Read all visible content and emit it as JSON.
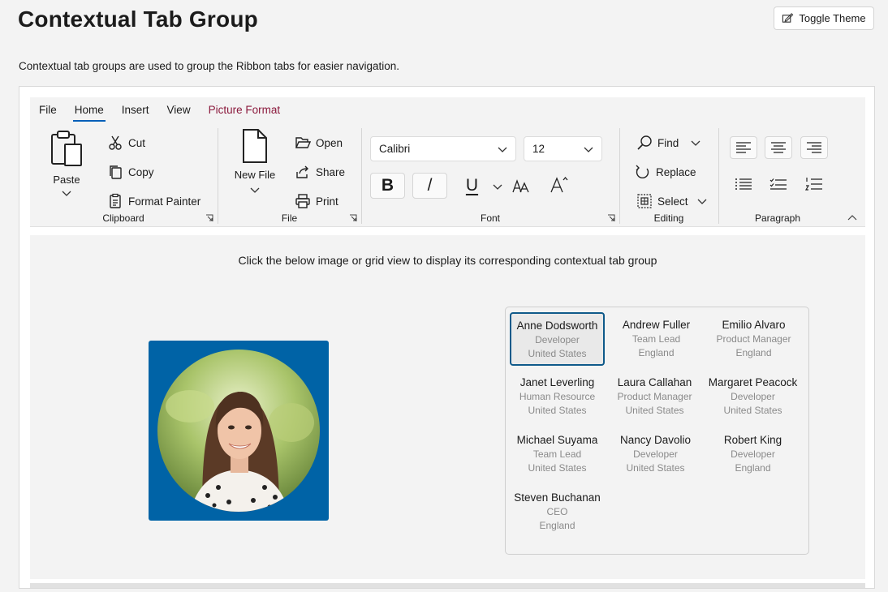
{
  "page": {
    "title": "Contextual Tab Group",
    "toggle_theme": "Toggle Theme",
    "description": "Contextual tab groups are used to group the Ribbon tabs for easier navigation."
  },
  "ribbon": {
    "tabs": [
      "File",
      "Home",
      "Insert",
      "View",
      "Picture Format"
    ],
    "active_tab": "Home",
    "contextual_tab": "Picture Format",
    "contextual_color": "#8b1a3d",
    "accent_color": "#005fb8",
    "clipboard": {
      "label": "Clipboard",
      "paste": "Paste",
      "cut": "Cut",
      "copy": "Copy",
      "format_painter": "Format Painter"
    },
    "file": {
      "label": "File",
      "new_file": "New File",
      "open": "Open",
      "share": "Share",
      "print": "Print"
    },
    "font": {
      "label": "Font",
      "family": "Calibri",
      "size": "12",
      "bold": "B",
      "italic": "/",
      "underline": "U"
    },
    "editing": {
      "label": "Editing",
      "find": "Find",
      "replace": "Replace",
      "select": "Select"
    },
    "paragraph": {
      "label": "Paragraph"
    }
  },
  "content": {
    "hint": "Click the below image or grid view to display its corresponding contextual tab group",
    "photo_frame_color": "#0063a6"
  },
  "people": [
    {
      "name": "Anne Dodsworth",
      "title": "Developer",
      "country": "United States",
      "selected": true
    },
    {
      "name": "Andrew Fuller",
      "title": "Team Lead",
      "country": "England"
    },
    {
      "name": "Emilio Alvaro",
      "title": "Product Manager",
      "country": "England"
    },
    {
      "name": "Janet Leverling",
      "title": "Human Resource",
      "country": "United States"
    },
    {
      "name": "Laura Callahan",
      "title": "Product Manager",
      "country": "United States"
    },
    {
      "name": "Margaret Peacock",
      "title": "Developer",
      "country": "United States"
    },
    {
      "name": "Michael Suyama",
      "title": "Team Lead",
      "country": "United States"
    },
    {
      "name": "Nancy Davolio",
      "title": "Developer",
      "country": "United States"
    },
    {
      "name": "Robert King",
      "title": "Developer",
      "country": "England"
    },
    {
      "name": "Steven Buchanan",
      "title": "CEO",
      "country": "England"
    }
  ]
}
